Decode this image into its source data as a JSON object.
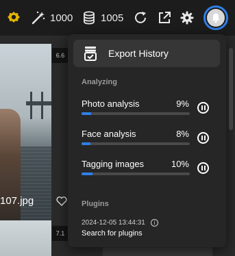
{
  "toolbar": {
    "magic_count": "1000",
    "coins_count": "1005",
    "icons": [
      "badge-icon",
      "magic-wand-icon",
      "coins-icon",
      "refresh-icon",
      "external-link-icon",
      "gear-icon",
      "bell-icon"
    ],
    "accent": "#2f7fe8"
  },
  "grid": {
    "filename": "107.jpg",
    "score_top": "6.6",
    "score_bottom": "7.1"
  },
  "panel": {
    "export_label": "Export History",
    "analyzing_title": "Analyzing",
    "tasks": [
      {
        "name": "Photo analysis",
        "percent": "9%",
        "progress": 0.09
      },
      {
        "name": "Face analysis",
        "percent": "8%",
        "progress": 0.08
      },
      {
        "name": "Tagging images",
        "percent": "10%",
        "progress": 0.1
      }
    ],
    "plugins_title": "Plugins",
    "plugin_date": "2024-12-05 13:44:31",
    "plugin_name": "Search for plugins"
  }
}
